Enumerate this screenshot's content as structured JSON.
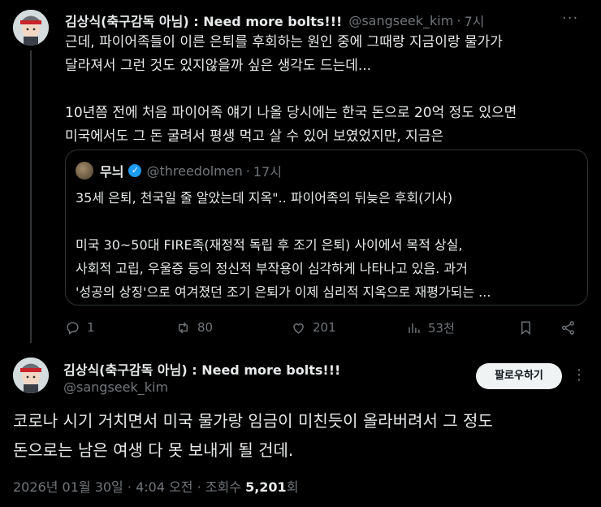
{
  "colors": {
    "background": "#000000",
    "text": "#e7e9ea",
    "muted": "#71767b",
    "border": "#2f3336",
    "verified": "#1d9bf0",
    "button_bg": "#eff3f4"
  },
  "tweet1": {
    "author_name": "김상식(축구감독 아님) : Need more bolts!!!",
    "handle": "@sangseek_kim",
    "separator": "·",
    "time": "7시",
    "text": "근데, 파이어족들이 이른 은퇴를 후회하는 원인 중에 그때랑 지금이랑 물가가\n달라져서 그런 것도 있지않을까 싶은 생각도 드는데...\n\n10년쯤 전에 처음 파이어족 얘기 나올 당시에는 한국 돈으로 20억 정도 있으면\n미국에서도 그 돈 굴려서 평생 먹고 살 수 있어 보였었지만, 지금은",
    "quote": {
      "author_name": "무늬",
      "handle": "@threedolmen",
      "separator": "·",
      "time": "17시",
      "text": "35세 은퇴, 천국일 줄 알았는데 지옥\".. 파이어족의 뒤늦은 후회(기사)\n\n미국 30~50대 FIRE족(재정적 독립 후 조기 은퇴) 사이에서 목적 상실,\n사회적 고립, 우울증 등의 정신적 부작용이 심각하게 나타나고 있음. 과거\n'성공의 상징'으로 여겨졌던 조기 은퇴가 이제 심리적 지옥으로 재평가되는 ..."
    },
    "actions": {
      "replies": "1",
      "retweets": "80",
      "likes": "201",
      "views": "53천"
    }
  },
  "tweet2": {
    "author_name": "김상식(축구감독 아님) : Need more bolts!!!",
    "handle": "@sangseek_kim",
    "follow_label": "팔로우하기",
    "text": "코로나 시기 거치면서 미국 물가랑 임금이 미친듯이 올라버려서 그 정도\n돈으로는 남은 여생 다 못 보내게 될 건데.",
    "date": "2026년 01월 30일",
    "time": "4:04 오전",
    "views_label": "조회수",
    "views_count": "5,201",
    "views_suffix": "회",
    "separator": "·"
  },
  "icons": [
    "avatar-icon",
    "more-icon",
    "verified-icon",
    "reply-icon",
    "retweet-icon",
    "like-icon",
    "views-icon",
    "bookmark-icon",
    "share-icon"
  ]
}
